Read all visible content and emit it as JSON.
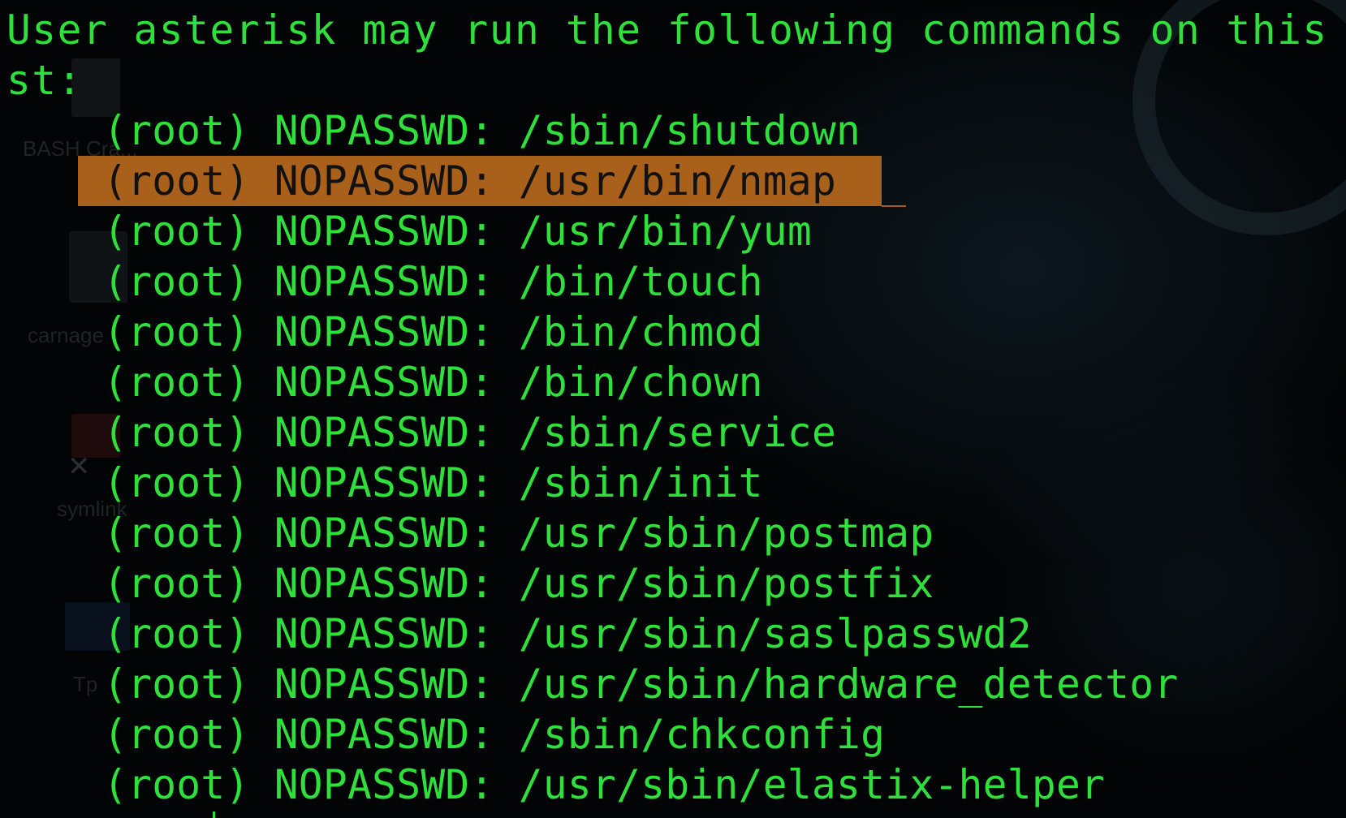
{
  "desktop": {
    "icon_labels": [
      "BASH Cra...",
      "carnage",
      "symlink",
      "Tp"
    ]
  },
  "terminal": {
    "header": "User asterisk may run the following commands on this ho",
    "header_wrap": "st:",
    "highlighted_index": 1,
    "entries": [
      "(root) NOPASSWD: /sbin/shutdown",
      "(root) NOPASSWD: /usr/bin/nmap ",
      "(root) NOPASSWD: /usr/bin/yum",
      "(root) NOPASSWD: /bin/touch",
      "(root) NOPASSWD: /bin/chmod",
      "(root) NOPASSWD: /bin/chown",
      "(root) NOPASSWD: /sbin/service",
      "(root) NOPASSWD: /sbin/init",
      "(root) NOPASSWD: /usr/sbin/postmap",
      "(root) NOPASSWD: /usr/sbin/postfix",
      "(root) NOPASSWD: /usr/sbin/saslpasswd2",
      "(root) NOPASSWD: /usr/sbin/hardware_detector",
      "(root) NOPASSWD: /sbin/chkconfig",
      "(root) NOPASSWD: /usr/sbin/elastix-helper"
    ]
  },
  "colors": {
    "terminal_text": "#2ee03a",
    "selection_background": "#a8601a",
    "selection_text": "#111111",
    "background": "#020405"
  }
}
